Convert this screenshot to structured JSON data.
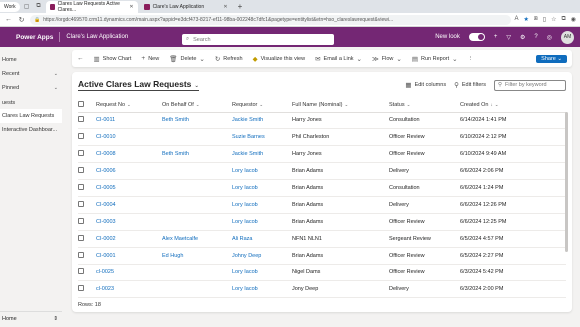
{
  "browser": {
    "profile_label": "Work",
    "tabs": [
      {
        "title": "Clares Law Requests Active Clares...",
        "active": true
      },
      {
        "title": "Clare's Law Application",
        "active": false
      }
    ],
    "url": "https://orgdc469570.crm11.dynamics.com/main.aspx?appid=e3dcf473-8217-ef11-98ba-002248c7dfc1&pagetype=entitylist&etn=hso_clareslawrequest&viewi..."
  },
  "appbar": {
    "brand": "Power Apps",
    "app_name": "Clare's Law Application",
    "search_placeholder": "Search",
    "new_look_label": "New look",
    "avatar_initials": "AM"
  },
  "sidebar": {
    "items": [
      {
        "label": "Home",
        "chevron": false
      },
      {
        "label": "Recent",
        "chevron": true
      },
      {
        "label": "Pinned",
        "chevron": true
      }
    ],
    "section": "uests",
    "entities": [
      {
        "label": "Clares Law Requests",
        "selected": true
      },
      {
        "label": "Interactive Dashboar...",
        "selected": false
      }
    ],
    "area": "Home"
  },
  "commandbar": {
    "show_chart": "Show Chart",
    "new": "New",
    "delete": "Delete",
    "refresh": "Refresh",
    "visualize": "Visualize this view",
    "email_link": "Email a Link",
    "flow": "Flow",
    "run_report": "Run Report",
    "share": "Share"
  },
  "view": {
    "title": "Active Clares Law Requests",
    "edit_columns": "Edit columns",
    "edit_filters": "Edit filters",
    "filter_placeholder": "Filter by keyword",
    "columns": [
      "Request No",
      "On Behalf Of",
      "Requestor",
      "Full Name (Nominal)",
      "Status",
      "Created On"
    ],
    "rows": [
      [
        "CI-0011",
        "Beth Smith",
        "Jackie Smith",
        "Harry Jones",
        "Consultation",
        "6/14/2024 1:41 PM"
      ],
      [
        "CI-0010",
        "",
        "Suzie Barnes",
        "Phil Charleston",
        "Officer Review",
        "6/10/2024 2:12 PM"
      ],
      [
        "CI-0008",
        "Beth Smith",
        "Jackie Smith",
        "Harry Jones",
        "Officer Review",
        "6/10/2024 9:49 AM"
      ],
      [
        "CI-0006",
        "",
        "Lory Iacob",
        "Brian Adams",
        "Delivery",
        "6/6/2024 2:06 PM"
      ],
      [
        "CI-0005",
        "",
        "Lory Iacob",
        "Brian Adams",
        "Consultation",
        "6/6/2024 1:24 PM"
      ],
      [
        "CI-0004",
        "",
        "Lory Iacob",
        "Brian Adams",
        "Delivery",
        "6/6/2024 12:26 PM"
      ],
      [
        "CI-0003",
        "",
        "Lory Iacob",
        "Brian Adams",
        "Officer Review",
        "6/6/2024 12:25 PM"
      ],
      [
        "CI-0002",
        "Alex Maetcalfe",
        "Ali Raza",
        "NFN1 NLN1",
        "Sergeant Review",
        "6/5/2024 4:57 PM"
      ],
      [
        "CI-0001",
        "Ed Hugh",
        "Johny Deep",
        "Brian Adams",
        "Officer Review",
        "6/5/2024 2:27 PM"
      ],
      [
        "cl-0025",
        "",
        "Lory Iacob",
        "Nigel Dams",
        "Officer Review",
        "6/3/2024 5:42 PM"
      ],
      [
        "cl-0023",
        "",
        "Lory Iacob",
        "Jony Deep",
        "Delivery",
        "6/3/2024 2:00 PM"
      ]
    ],
    "rows_footer": "Rows: 18"
  }
}
